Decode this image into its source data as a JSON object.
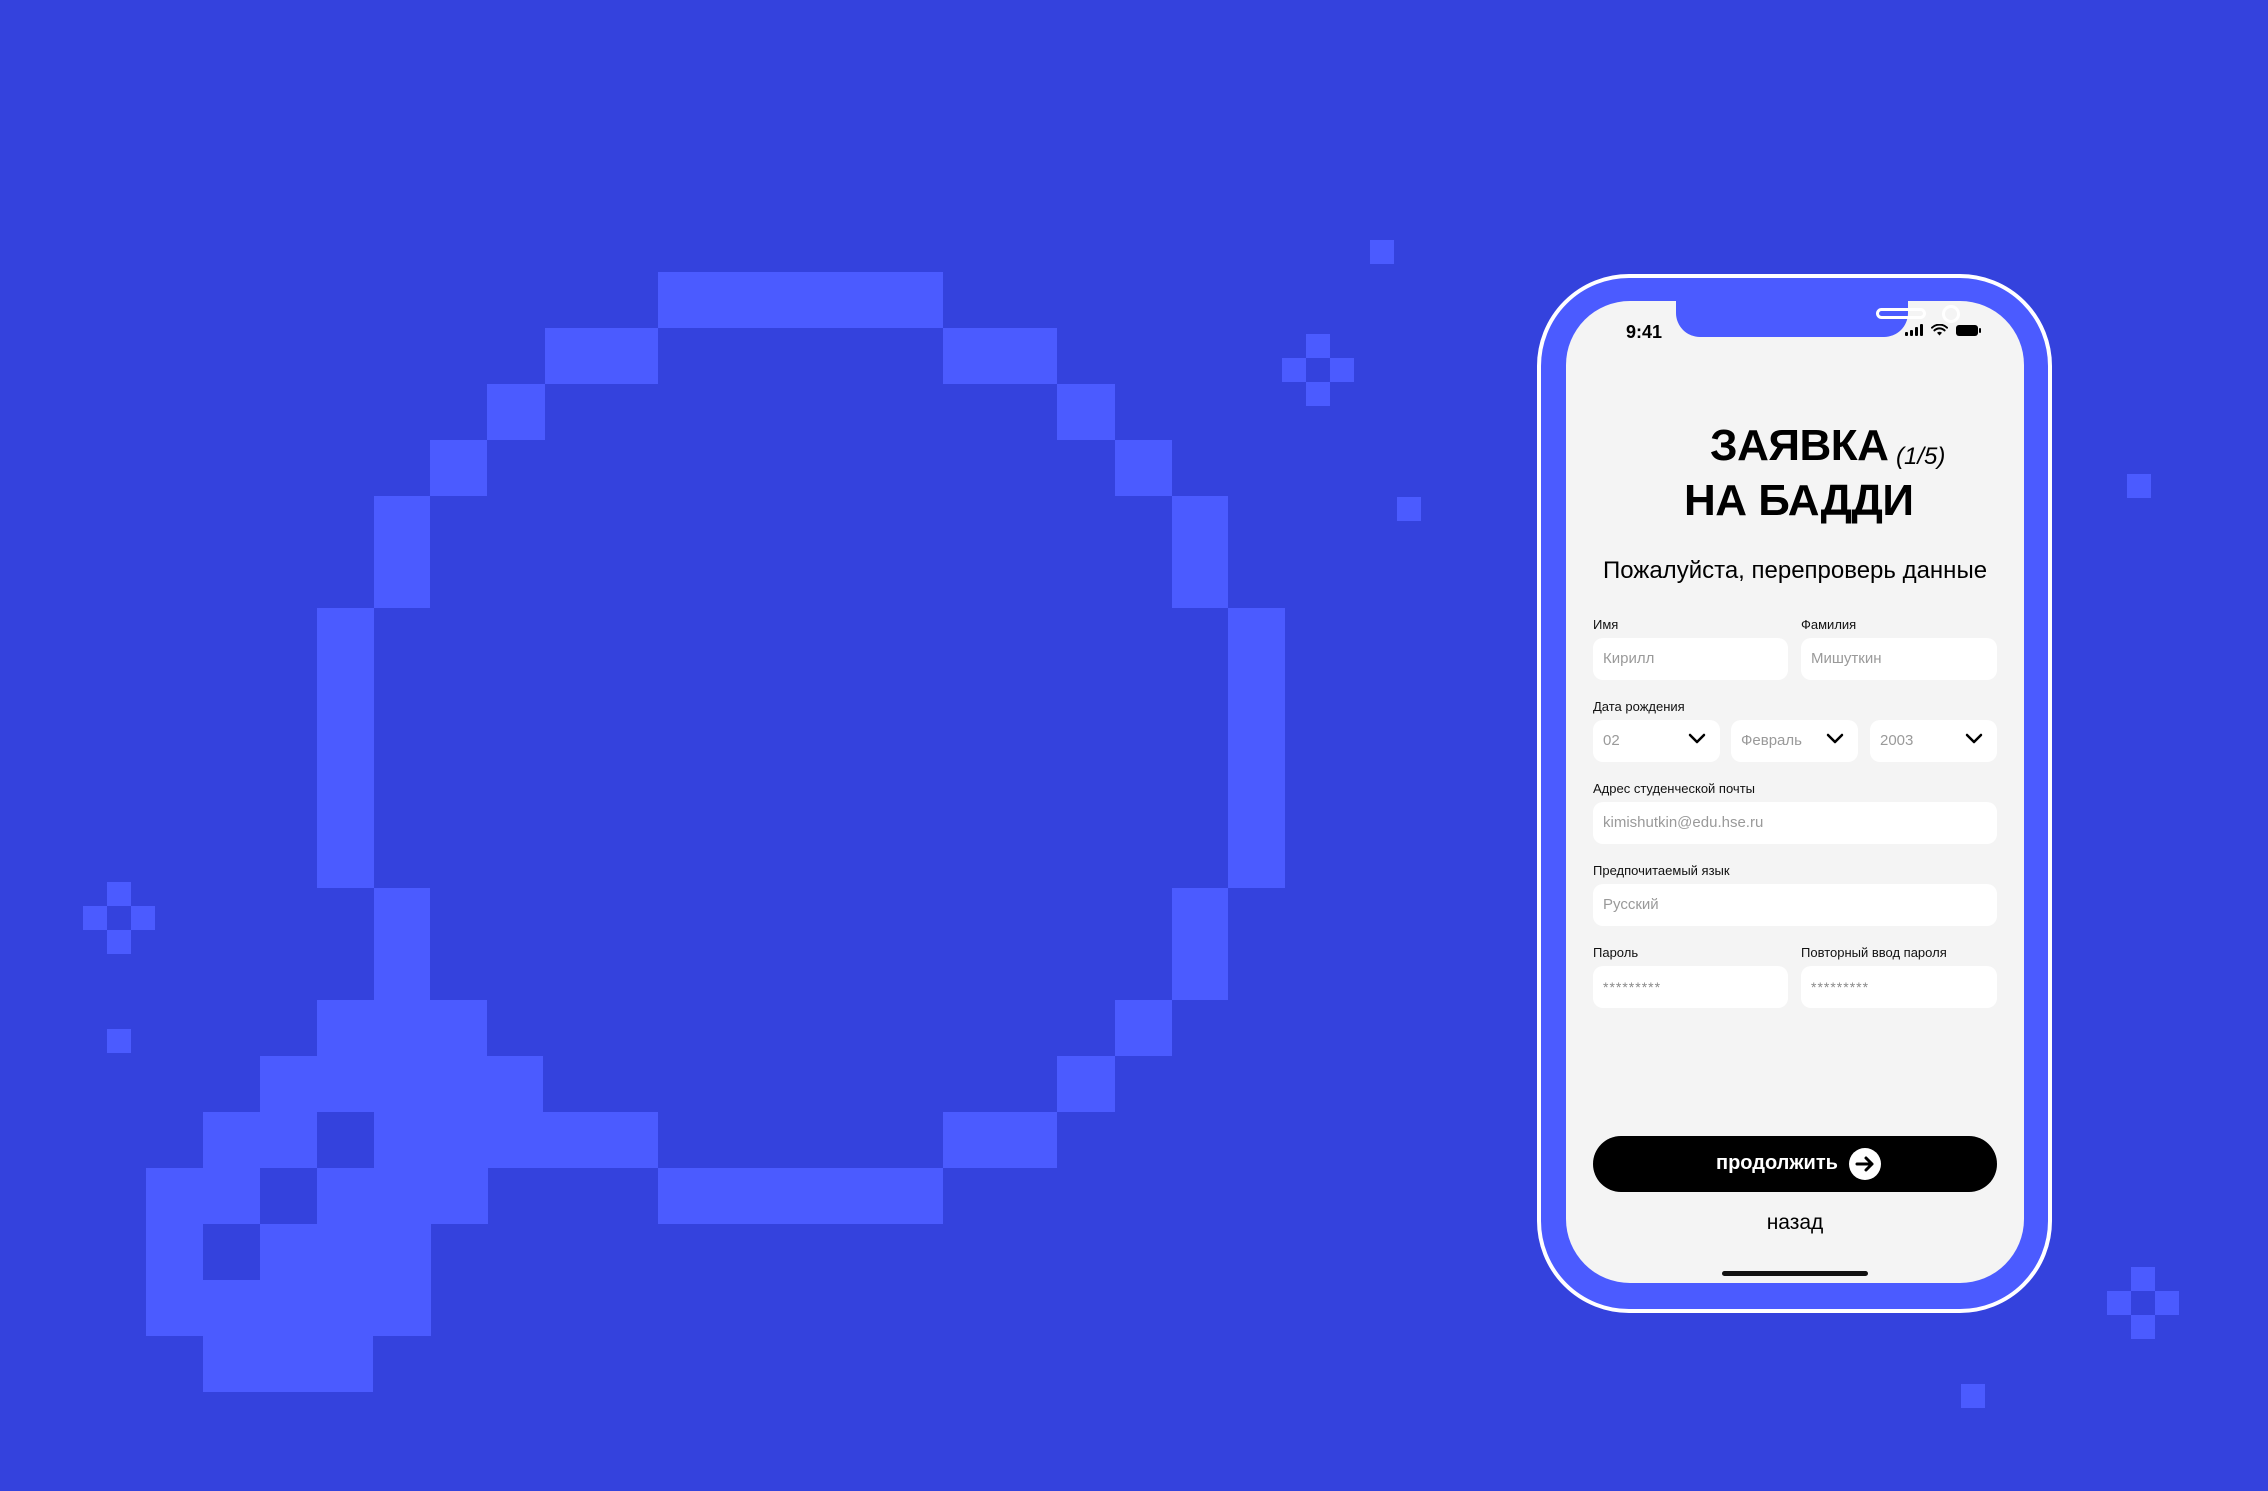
{
  "colors": {
    "background": "#3442dd",
    "pixel_accent": "#4b5bff",
    "phone_frame": "#4b5bff",
    "screen_bg": "#f4f4f4",
    "button_bg": "#000000",
    "button_text": "#ffffff"
  },
  "decoration": {
    "main_icon": "pixel-magnifier-icon",
    "sparkles": [
      "sparkle-icon",
      "sparkle-icon",
      "sparkle-icon"
    ]
  },
  "status_bar": {
    "time": "9:41",
    "icons": [
      "cellular-signal-icon",
      "wifi-icon",
      "battery-icon"
    ]
  },
  "form": {
    "title_line1": "ЗАЯВКА",
    "title_line2": "НА БАДДИ",
    "step": "(1/5)",
    "subtitle": "Пожалуйста, перепроверь данные",
    "first_name": {
      "label": "Имя",
      "value": "Кирилл"
    },
    "last_name": {
      "label": "Фамилия",
      "value": "Мишуткин"
    },
    "birth_date": {
      "label": "Дата рождения",
      "day": "02",
      "month": "Февраль",
      "year": "2003"
    },
    "email": {
      "label": "Адрес студенческой почты",
      "value": "kimishutkin@edu.hse.ru"
    },
    "language": {
      "label": "Предпочитаемый язык",
      "value": "Русский"
    },
    "password": {
      "label": "Пароль",
      "value": "*********"
    },
    "password_repeat": {
      "label": "Повторный ввод пароля",
      "value": "*********"
    },
    "continue_label": "продолжить",
    "continue_icon": "arrow-right-circle-icon",
    "back_label": "назад"
  }
}
